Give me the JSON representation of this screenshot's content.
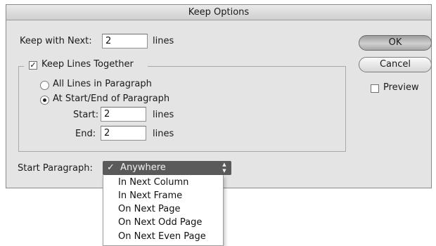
{
  "dialog": {
    "title": "Keep Options",
    "keep_with_next": {
      "label": "Keep with Next:",
      "value": "2",
      "unit": "lines"
    },
    "keep_lines_together": {
      "label": "Keep Lines Together",
      "checked": true
    },
    "all_lines": {
      "label": "All Lines in Paragraph",
      "selected": false
    },
    "at_start_end": {
      "label": "At Start/End of Paragraph",
      "selected": true
    },
    "start": {
      "label": "Start:",
      "value": "2",
      "unit": "lines"
    },
    "end": {
      "label": "End:",
      "value": "2",
      "unit": "lines"
    },
    "ok_label": "OK",
    "cancel_label": "Cancel",
    "preview": {
      "label": "Preview",
      "checked": false
    },
    "start_paragraph": {
      "label": "Start Paragraph:",
      "check_mark": "✓",
      "selected": "Anywhere",
      "options": [
        "In Next Column",
        "In Next Frame",
        "On Next Page",
        "On Next Odd Page",
        "On Next Even Page"
      ]
    }
  },
  "colors": {
    "dialog_bg": "#e4e4e4",
    "select_bg": "#5a5a5a",
    "ok_button": "#b5b5b5"
  }
}
